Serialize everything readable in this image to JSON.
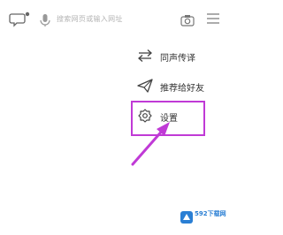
{
  "topbar": {
    "search_placeholder": "搜索网页或输入网址",
    "icons": [
      "message-icon",
      "microphone-icon",
      "camera-icon",
      "menu-icon"
    ]
  },
  "menu": {
    "items": [
      {
        "label": "同声传译",
        "icon": "swap-arrows-icon"
      },
      {
        "label": "推荐给好友",
        "icon": "paper-plane-icon"
      },
      {
        "label": "设置",
        "icon": "gear-icon"
      }
    ]
  },
  "annotation": {
    "highlight_color": "#c03ad6",
    "arrow_color": "#c03ad6"
  },
  "watermark": {
    "brand": "592下载网",
    "brand_color": "#2a7fd4"
  }
}
